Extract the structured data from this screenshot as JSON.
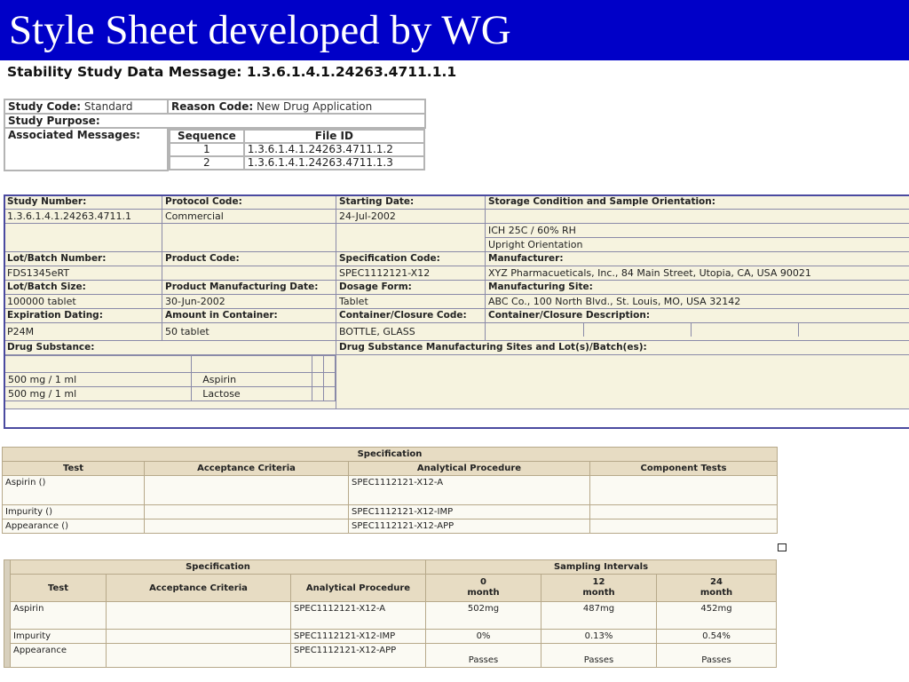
{
  "banner": {
    "title": "Style Sheet developed by WG"
  },
  "message_title": "Stability Study Data Message: 1.3.6.1.4.1.24263.4711.1.1",
  "header": {
    "study_code_label": "Study Code:",
    "study_code_value": "Standard",
    "reason_code_label": "Reason Code:",
    "reason_code_value": "New Drug Application",
    "study_purpose_label": "Study Purpose:",
    "assoc_label": "Associated Messages:",
    "assoc_cols": [
      "Sequence",
      "File ID"
    ],
    "assoc_rows": [
      {
        "seq": "1",
        "file": "1.3.6.1.4.1.24263.4711.1.2"
      },
      {
        "seq": "2",
        "file": "1.3.6.1.4.1.24263.4711.1.3"
      }
    ]
  },
  "study": {
    "study_number_label": "Study Number:",
    "study_number": "1.3.6.1.4.1.24263.4711.1",
    "protocol_code_label": "Protocol Code:",
    "protocol_code": "Commercial",
    "starting_date_label": "Starting Date:",
    "starting_date": "24-Jul-2002",
    "storage_label": "Storage Condition and Sample Orientation:",
    "storage_condition": "ICH 25C / 60% RH",
    "orientation": "Upright Orientation",
    "lot_number_label": "Lot/Batch Number:",
    "lot_number": "FDS1345eRT",
    "product_code_label": "Product Code:",
    "product_code": "",
    "spec_code_label": "Specification Code:",
    "spec_code": "SPEC1112121-X12",
    "manufacturer_label": "Manufacturer:",
    "manufacturer": "XYZ Pharmacueticals, Inc., 84 Main Street, Utopia, CA, USA 90021",
    "lot_size_label": "Lot/Batch Size:",
    "lot_size": "100000 tablet",
    "mfg_date_label": "Product Manufacturing Date:",
    "mfg_date": "30-Jun-2002",
    "dosage_form_label": "Dosage Form:",
    "dosage_form": "Tablet",
    "mfg_site_label": "Manufacturing Site:",
    "mfg_site": "ABC Co., 100 North Blvd., St. Louis, MO, USA 32142",
    "expiration_label": "Expiration Dating:",
    "expiration": "P24M",
    "amount_label": "Amount in Container:",
    "amount": "50 tablet",
    "closure_code_label": "Container/Closure Code:",
    "closure_code": "BOTTLE, GLASS",
    "closure_desc_label": "Container/Closure Description:",
    "drug_substance_label": "Drug Substance:",
    "drug_substance_sites_label": "Drug Substance Manufacturing Sites and Lot(s)/Batch(es):",
    "substances": [
      {
        "amount": "500 mg / 1 ml",
        "name": "Aspirin"
      },
      {
        "amount": "500 mg / 1 ml",
        "name": "Lactose"
      }
    ]
  },
  "spec1": {
    "group_header": "Specification",
    "columns": [
      "Test",
      "Acceptance Criteria",
      "Analytical Procedure",
      "Component Tests"
    ],
    "rows": [
      {
        "test": "Aspirin ()",
        "criteria": "",
        "procedure": "SPEC1112121-X12-A",
        "component": ""
      },
      {
        "test": "Impurity ()",
        "criteria": "",
        "procedure": "SPEC1112121-X12-IMP",
        "component": ""
      },
      {
        "test": "Appearance ()",
        "criteria": "",
        "procedure": "SPEC1112121-X12-APP",
        "component": ""
      }
    ]
  },
  "spec2": {
    "group_header": "Specification",
    "sampling_header": "Sampling Intervals",
    "columns": [
      "Test",
      "Acceptance Criteria",
      "Analytical Procedure"
    ],
    "intervals": [
      {
        "num": "0",
        "unit": "month"
      },
      {
        "num": "12",
        "unit": "month"
      },
      {
        "num": "24",
        "unit": "month"
      }
    ],
    "rows": [
      {
        "test": "Aspirin",
        "criteria": "",
        "procedure": "SPEC1112121-X12-A",
        "v0": "502mg",
        "v12": "487mg",
        "v24": "452mg"
      },
      {
        "test": "Impurity",
        "criteria": "",
        "procedure": "SPEC1112121-X12-IMP",
        "v0": "0%",
        "v12": "0.13%",
        "v24": "0.54%"
      },
      {
        "test": "Appearance",
        "criteria": "",
        "procedure": "SPEC1112121-X12-APP",
        "v0": "Passes",
        "v12": "Passes",
        "v24": "Passes"
      }
    ]
  }
}
